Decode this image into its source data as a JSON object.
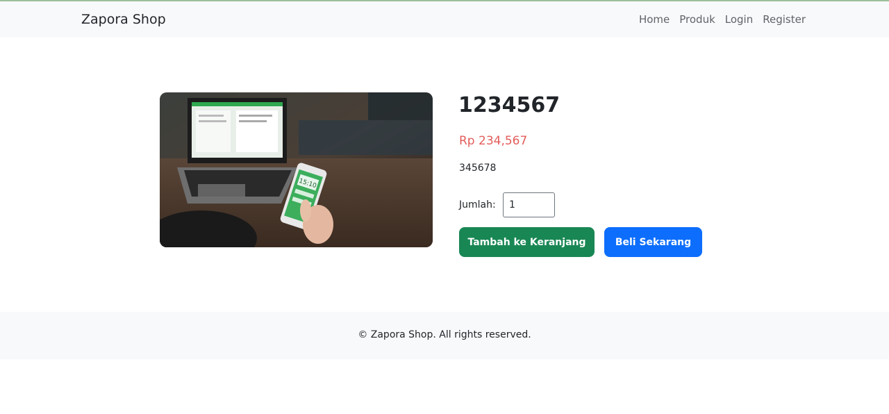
{
  "navbar": {
    "brand": "Zapora Shop",
    "links": [
      "Home",
      "Produk",
      "Login",
      "Register"
    ]
  },
  "product": {
    "image": "laptop-and-phone-photo",
    "title": "1234567",
    "price": "Rp 234,567",
    "description": "345678",
    "qty_label": "Jumlah:",
    "qty_value": "1",
    "add_to_cart_label": "Tambah ke Keranjang",
    "buy_now_label": "Beli Sekarang",
    "phone_screen_text": "15:10"
  },
  "footer": {
    "text": "© Zapora Shop. All rights reserved."
  },
  "colors": {
    "price": "#e35d5b",
    "add_to_cart": "#198754",
    "buy_now": "#0d6efd",
    "navbar_bg": "#f8f9fa"
  }
}
